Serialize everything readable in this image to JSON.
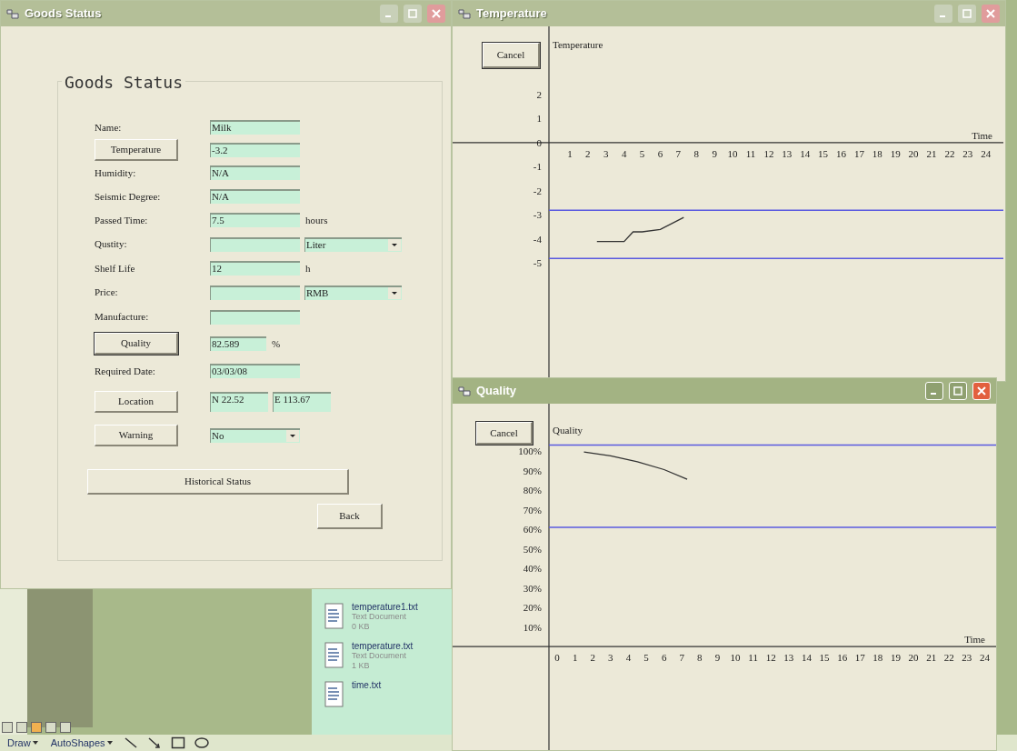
{
  "goods_window": {
    "title": "Goods Status",
    "group_title": "Goods Status",
    "fields": [
      {
        "kind": "label",
        "label": "Name:",
        "value": "Milk"
      },
      {
        "kind": "button",
        "label": "Temperature",
        "value": "-3.2",
        "default": false
      },
      {
        "kind": "label",
        "label": "Humidity:",
        "value": "N/A"
      },
      {
        "kind": "label",
        "label": "Seismic Degree:",
        "value": "N/A"
      },
      {
        "kind": "label",
        "label": "Passed Time:",
        "value": "7.5",
        "unit": "hours"
      },
      {
        "kind": "label",
        "label": "Qustity:",
        "dropdown": "Liter"
      },
      {
        "kind": "label",
        "label": "Shelf Life",
        "value": "12",
        "unit": "h"
      },
      {
        "kind": "label",
        "label": "Price:",
        "dropdown": "RMB"
      },
      {
        "kind": "label",
        "label": "Manufacture:"
      },
      {
        "kind": "button",
        "label": "Quality",
        "short_value": "82.589",
        "unit": "%",
        "default": true
      },
      {
        "kind": "label",
        "label": "Required Date:",
        "value": "03/03/08"
      },
      {
        "kind": "button",
        "label": "Location",
        "coords": [
          "N 22.52",
          "E 113.67"
        ],
        "default": false
      },
      {
        "kind": "button",
        "label": "Warning",
        "short_dropdown": "No",
        "default": false
      }
    ],
    "historical_button": "Historical Status",
    "back_button": "Back"
  },
  "temperature_window": {
    "title": "Temperature",
    "cancel_button": "Cancel",
    "chart_data": {
      "type": "line",
      "title": "Temperature",
      "xlabel": "Time",
      "series": [
        {
          "color": "#333333",
          "x": [
            2.5,
            4,
            4.5,
            5,
            6,
            7.3
          ],
          "values": [
            -4.1,
            -4.1,
            -3.7,
            -3.7,
            -3.6,
            -3.1
          ]
        }
      ],
      "xlim": [
        -5.48,
        24.97
      ],
      "ylim": [
        -9.89,
        4.83
      ],
      "xticks": [
        1,
        2,
        3,
        4,
        5,
        6,
        7,
        8,
        9,
        10,
        11,
        12,
        13,
        14,
        15,
        16,
        17,
        18,
        19,
        20,
        21,
        22,
        23,
        24
      ],
      "yticks": [
        2,
        1,
        0,
        -1,
        -2,
        -3,
        -4,
        -5
      ],
      "ref_lines": [
        {
          "axis": "y",
          "value": -2.8
        },
        {
          "axis": "y",
          "value": -4.8
        }
      ]
    }
  },
  "quality_window": {
    "title": "Quality",
    "cancel_button": "Cancel",
    "chart_data": {
      "type": "line",
      "title": "Quality",
      "xlabel": "Time",
      "series": [
        {
          "color": "#333333",
          "x": [
            1.5,
            3,
            4.5,
            6,
            7.3
          ],
          "values": [
            99.5,
            97.5,
            94.5,
            90.5,
            85.5
          ]
        }
      ],
      "xlim": [
        -5.87,
        24.64
      ],
      "ylim": [
        -53,
        124.2
      ],
      "xticks": [
        0,
        1,
        2,
        3,
        4,
        5,
        6,
        7,
        8,
        9,
        10,
        11,
        12,
        13,
        14,
        15,
        16,
        17,
        18,
        19,
        20,
        21,
        22,
        23,
        24
      ],
      "yticks": [
        {
          "value": 100,
          "label": "100%"
        },
        {
          "value": 90,
          "label": "90%"
        },
        {
          "value": 80,
          "label": "80%"
        },
        {
          "value": 70,
          "label": "70%"
        },
        {
          "value": 60,
          "label": "60%"
        },
        {
          "value": 50,
          "label": "50%"
        },
        {
          "value": 40,
          "label": "40%"
        },
        {
          "value": 30,
          "label": "30%"
        },
        {
          "value": 20,
          "label": "20%"
        },
        {
          "value": 10,
          "label": "10%"
        }
      ],
      "ref_lines": [
        {
          "axis": "y",
          "value": 103
        },
        {
          "axis": "y",
          "value": 61
        }
      ]
    }
  },
  "desktop": {
    "files": [
      {
        "name": "temperature1.txt",
        "type": "Text Document",
        "size": "0 KB"
      },
      {
        "name": "temperature.txt",
        "type": "Text Document",
        "size": "1 KB"
      },
      {
        "name": "time.txt"
      }
    ],
    "toolbar": [
      "Draw",
      "AutoShapes"
    ]
  }
}
